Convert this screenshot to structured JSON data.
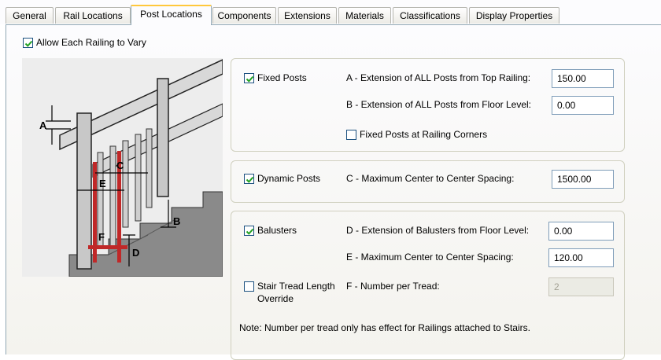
{
  "tabs": [
    {
      "label": "General"
    },
    {
      "label": "Rail Locations"
    },
    {
      "label": "Post Locations",
      "active": true
    },
    {
      "label": "Components"
    },
    {
      "label": "Extensions"
    },
    {
      "label": "Materials"
    },
    {
      "label": "Classifications"
    },
    {
      "label": "Display Properties"
    }
  ],
  "allow_vary": {
    "label": "Allow Each Railing to Vary",
    "checked": true
  },
  "illustration": {
    "labels": {
      "a": "A",
      "b": "B",
      "c": "C",
      "d": "D",
      "e": "E",
      "f": "F"
    }
  },
  "fixed_posts": {
    "label": "Fixed Posts",
    "checked": true,
    "ext_top": {
      "label": "A - Extension of ALL Posts from Top Railing:",
      "value": "150.00"
    },
    "ext_floor": {
      "label": "B - Extension of ALL Posts from Floor Level:",
      "value": "0.00"
    },
    "corners": {
      "label": "Fixed Posts at Railing Corners",
      "checked": false
    }
  },
  "dynamic_posts": {
    "label": "Dynamic Posts",
    "checked": true,
    "spacing": {
      "label": "C - Maximum Center to Center Spacing:",
      "value": "1500.00"
    }
  },
  "balusters": {
    "label": "Balusters",
    "checked": true,
    "ext_floor": {
      "label": "D - Extension of Balusters from Floor Level:",
      "value": "0.00"
    },
    "spacing": {
      "label": "E - Maximum Center to Center Spacing:",
      "value": "120.00"
    },
    "override": {
      "label_line1": "Stair Tread Length",
      "label_line2": "Override",
      "checked": false
    },
    "per_tread": {
      "label": "F - Number per Tread:",
      "value": "2",
      "disabled": true
    },
    "note": "Note: Number per tread only has effect for Railings attached to Stairs."
  },
  "colors": {
    "accent": "#ffc83c",
    "checkmark": "#21a121",
    "tab_border": "#91a7b4"
  }
}
